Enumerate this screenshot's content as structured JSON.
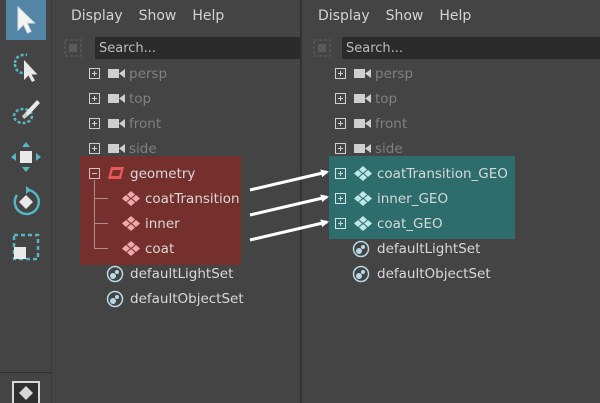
{
  "toolbox": {
    "tools": [
      {
        "icon": "select-arrow-icon",
        "active": true
      },
      {
        "icon": "lasso-select-icon",
        "active": false
      },
      {
        "icon": "paint-select-icon",
        "active": false
      },
      {
        "icon": "move-tool-icon",
        "active": false
      },
      {
        "icon": "rotate-tool-icon",
        "active": false
      },
      {
        "icon": "scale-tool-icon",
        "active": false
      },
      {
        "icon": "layout-icon",
        "active": false
      }
    ]
  },
  "left_outliner": {
    "menus": [
      "Display",
      "Show",
      "Help"
    ],
    "search_placeholder": "Search...",
    "items": [
      {
        "label": "persp",
        "icon": "camera-icon",
        "style": "dim"
      },
      {
        "label": "top",
        "icon": "camera-icon",
        "style": "dim"
      },
      {
        "label": "front",
        "icon": "camera-icon",
        "style": "dim"
      },
      {
        "label": "side",
        "icon": "camera-icon",
        "style": "dim"
      },
      {
        "label": "geometry",
        "icon": "group-transform-icon",
        "style": "normal"
      },
      {
        "label": "coatTransition",
        "icon": "mesh-icon",
        "style": "normal"
      },
      {
        "label": "inner",
        "icon": "mesh-icon",
        "style": "normal"
      },
      {
        "label": "coat",
        "icon": "mesh-icon",
        "style": "normal"
      },
      {
        "label": "defaultLightSet",
        "icon": "set-icon",
        "style": "normal"
      },
      {
        "label": "defaultObjectSet",
        "icon": "set-icon",
        "style": "normal"
      }
    ]
  },
  "right_outliner": {
    "menus": [
      "Display",
      "Show",
      "Help"
    ],
    "search_placeholder": "Search...",
    "items": [
      {
        "label": "persp",
        "icon": "camera-icon",
        "style": "dim"
      },
      {
        "label": "top",
        "icon": "camera-icon",
        "style": "dim"
      },
      {
        "label": "front",
        "icon": "camera-icon",
        "style": "dim"
      },
      {
        "label": "side",
        "icon": "camera-icon",
        "style": "dim"
      },
      {
        "label": "coatTransition_GEO",
        "icon": "mesh-icon",
        "style": "normal"
      },
      {
        "label": "inner_GEO",
        "icon": "mesh-icon",
        "style": "normal"
      },
      {
        "label": "coat_GEO",
        "icon": "mesh-icon",
        "style": "normal"
      },
      {
        "label": "defaultLightSet",
        "icon": "set-icon",
        "style": "normal"
      },
      {
        "label": "defaultObjectSet",
        "icon": "set-icon",
        "style": "normal"
      }
    ]
  },
  "colors": {
    "active_tool": "#5285a6",
    "left_highlight": "#7a2f2c",
    "right_highlight": "#2c7070",
    "mesh_icon_left": "#f0a8a8",
    "mesh_icon_right": "#bfe8e8"
  }
}
